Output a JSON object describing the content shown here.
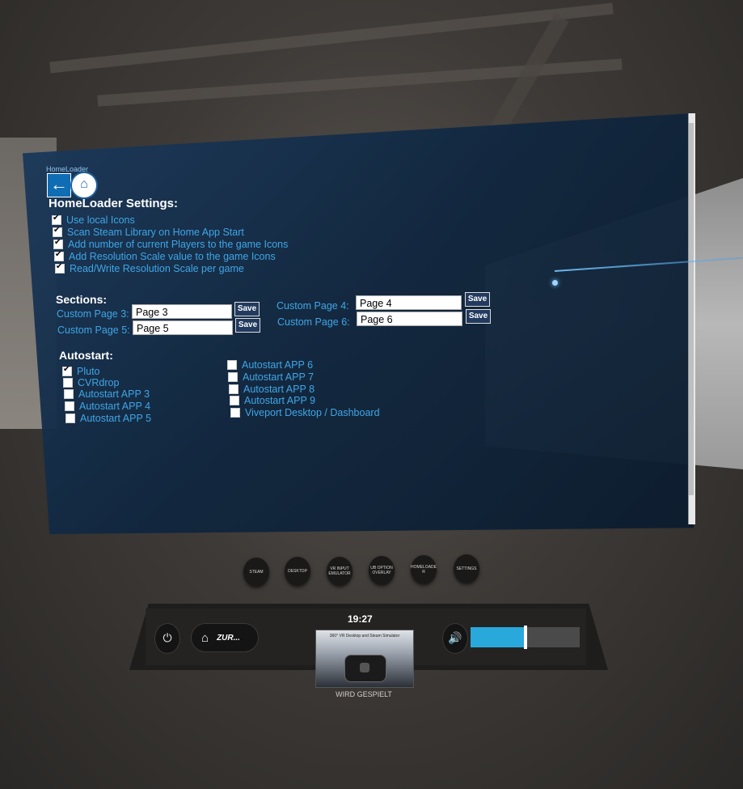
{
  "homeloader": {
    "app_label": "HomeLoader",
    "title": "HomeLoader Settings:",
    "options": [
      {
        "label": "Use local Icons",
        "checked": true
      },
      {
        "label": "Scan Steam Library on Home App Start",
        "checked": true
      },
      {
        "label": "Add number of current Players to the game Icons",
        "checked": true
      },
      {
        "label": "Add Resolution Scale value to the game Icons",
        "checked": true
      },
      {
        "label": "Read/Write Resolution Scale per game",
        "checked": true
      }
    ]
  },
  "sections": {
    "title": "Sections:",
    "pages": [
      {
        "label": "Custom Page 3:",
        "value": "Page 3",
        "save": "Save"
      },
      {
        "label": "Custom Page 4:",
        "value": "Page 4",
        "save": "Save"
      },
      {
        "label": "Custom Page 5:",
        "value": "Page 5",
        "save": "Save"
      },
      {
        "label": "Custom Page 6:",
        "value": "Page 6",
        "save": "Save"
      }
    ]
  },
  "autostart": {
    "title": "Autostart:",
    "left": [
      {
        "label": "Pluto",
        "checked": true
      },
      {
        "label": "CVRdrop",
        "checked": false
      },
      {
        "label": "Autostart APP 3",
        "checked": false
      },
      {
        "label": "Autostart APP 4",
        "checked": false
      },
      {
        "label": "Autostart APP 5",
        "checked": false
      }
    ],
    "right": [
      {
        "label": "Autostart APP 6",
        "checked": false
      },
      {
        "label": "Autostart APP 7",
        "checked": false
      },
      {
        "label": "Autostart APP 8",
        "checked": false
      },
      {
        "label": "Autostart APP 9",
        "checked": false
      },
      {
        "label": "Viveport Desktop / Dashboard",
        "checked": false
      }
    ]
  },
  "dashboard": {
    "overlay_buttons": [
      "STEAM",
      "DESKTOP",
      "VR INPUT EMULATOR",
      "UB OPTION OVERLAY",
      "HOMELOADE R",
      "SETTINGS"
    ],
    "home_label": "ZUR...",
    "clock": "19:27",
    "now_playing_title": "360° VR Desktop and Steam Simulator",
    "now_playing_status": "WIRD GESPIELT",
    "volume_fraction": 0.5,
    "accent_color": "#29a8dc"
  }
}
